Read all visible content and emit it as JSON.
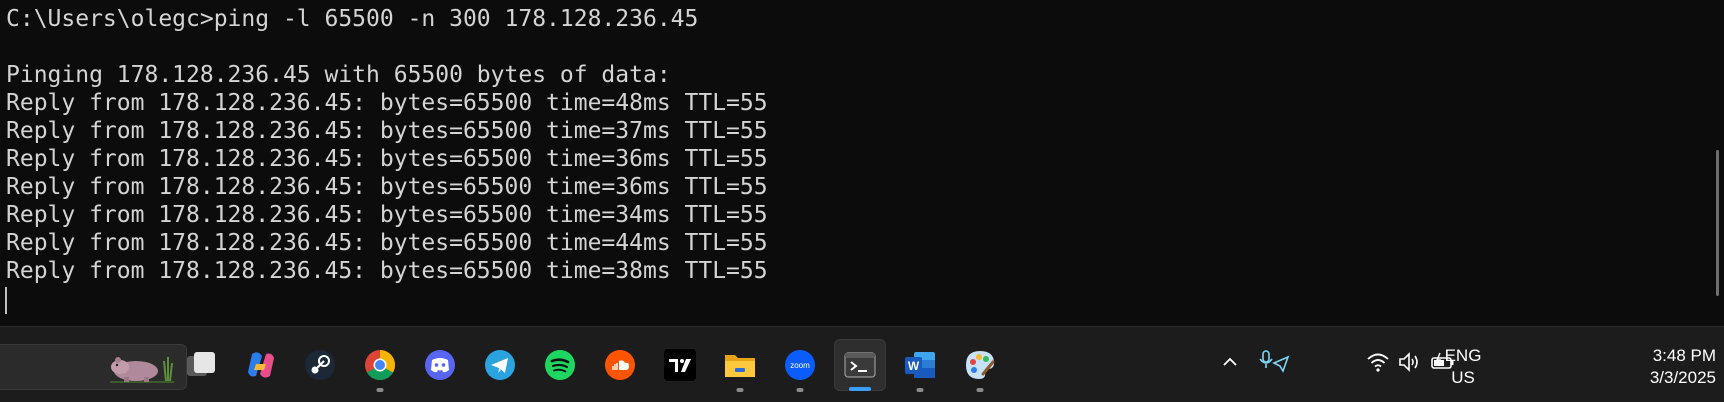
{
  "terminal": {
    "lines": [
      "C:\\Users\\olegc>ping -l 65500 -n 300 178.128.236.45",
      "",
      "Pinging 178.128.236.45 with 65500 bytes of data:",
      "Reply from 178.128.236.45: bytes=65500 time=48ms TTL=55",
      "Reply from 178.128.236.45: bytes=65500 time=37ms TTL=55",
      "Reply from 178.128.236.45: bytes=65500 time=36ms TTL=55",
      "Reply from 178.128.236.45: bytes=65500 time=36ms TTL=55",
      "Reply from 178.128.236.45: bytes=65500 time=34ms TTL=55",
      "Reply from 178.128.236.45: bytes=65500 time=44ms TTL=55",
      "Reply from 178.128.236.45: bytes=65500 time=38ms TTL=55"
    ],
    "text_color": "#d4d4d4",
    "background": "#0c0c0c"
  },
  "taskbar": {
    "apps": [
      {
        "name": "task-view",
        "icon": "task-view-icon"
      },
      {
        "name": "copilot",
        "icon": "copilot-icon"
      },
      {
        "name": "steam",
        "icon": "steam-icon"
      },
      {
        "name": "chrome",
        "icon": "chrome-icon",
        "running": true
      },
      {
        "name": "discord",
        "icon": "discord-icon"
      },
      {
        "name": "telegram",
        "icon": "telegram-icon"
      },
      {
        "name": "spotify",
        "icon": "spotify-icon"
      },
      {
        "name": "soundcloud",
        "icon": "soundcloud-icon"
      },
      {
        "name": "tradingview",
        "icon": "tradingview-icon"
      },
      {
        "name": "file-explorer",
        "icon": "folder-icon",
        "running": true
      },
      {
        "name": "zoom",
        "icon": "zoom-icon",
        "label": "zoom",
        "running": true
      },
      {
        "name": "terminal",
        "icon": "terminal-icon",
        "running": true,
        "active": true
      },
      {
        "name": "word",
        "icon": "word-icon",
        "label": "W",
        "running": true
      },
      {
        "name": "paint",
        "icon": "paint-icon",
        "running": true
      }
    ],
    "tray": {
      "language_line1": "ENG",
      "language_line2": "US",
      "time": "3:48 PM",
      "date": "3/3/2025",
      "icons": [
        "chevron-up-icon",
        "microphone-location-icon",
        "wifi-icon",
        "volume-icon",
        "battery-icon"
      ]
    },
    "accent": "#3aa0ff"
  }
}
